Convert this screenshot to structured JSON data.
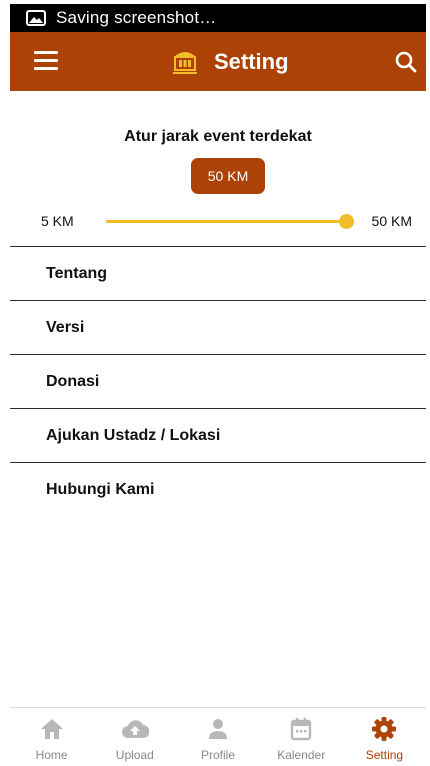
{
  "status_bar": {
    "text": "Saving screenshot…",
    "icon": "image-icon"
  },
  "app_bar": {
    "title": "Setting",
    "menu_icon": "menu-icon",
    "search_icon": "search-icon",
    "logo": "mosque-logo"
  },
  "distance": {
    "title": "Atur jarak event terdekat",
    "selected_label": "50 KM",
    "min_label": "5 KM",
    "max_label": "50 KM",
    "slider_min": 5,
    "slider_max": 50,
    "slider_value": 50
  },
  "menu": {
    "items": [
      {
        "label": "Tentang"
      },
      {
        "label": "Versi"
      },
      {
        "label": "Donasi"
      },
      {
        "label": "Ajukan Ustadz / Lokasi"
      },
      {
        "label": "Hubungi Kami"
      }
    ]
  },
  "bottom_nav": {
    "items": [
      {
        "label": "Home",
        "icon": "home-icon"
      },
      {
        "label": "Upload",
        "icon": "cloud-upload-icon"
      },
      {
        "label": "Profile",
        "icon": "person-icon"
      },
      {
        "label": "Kalender",
        "icon": "calendar-icon"
      },
      {
        "label": "Setting",
        "icon": "gear-icon"
      }
    ],
    "active": "Setting"
  },
  "colors": {
    "primary": "#ad4207",
    "accent": "#f2bd2b",
    "inactive": "#b8b8b8"
  }
}
